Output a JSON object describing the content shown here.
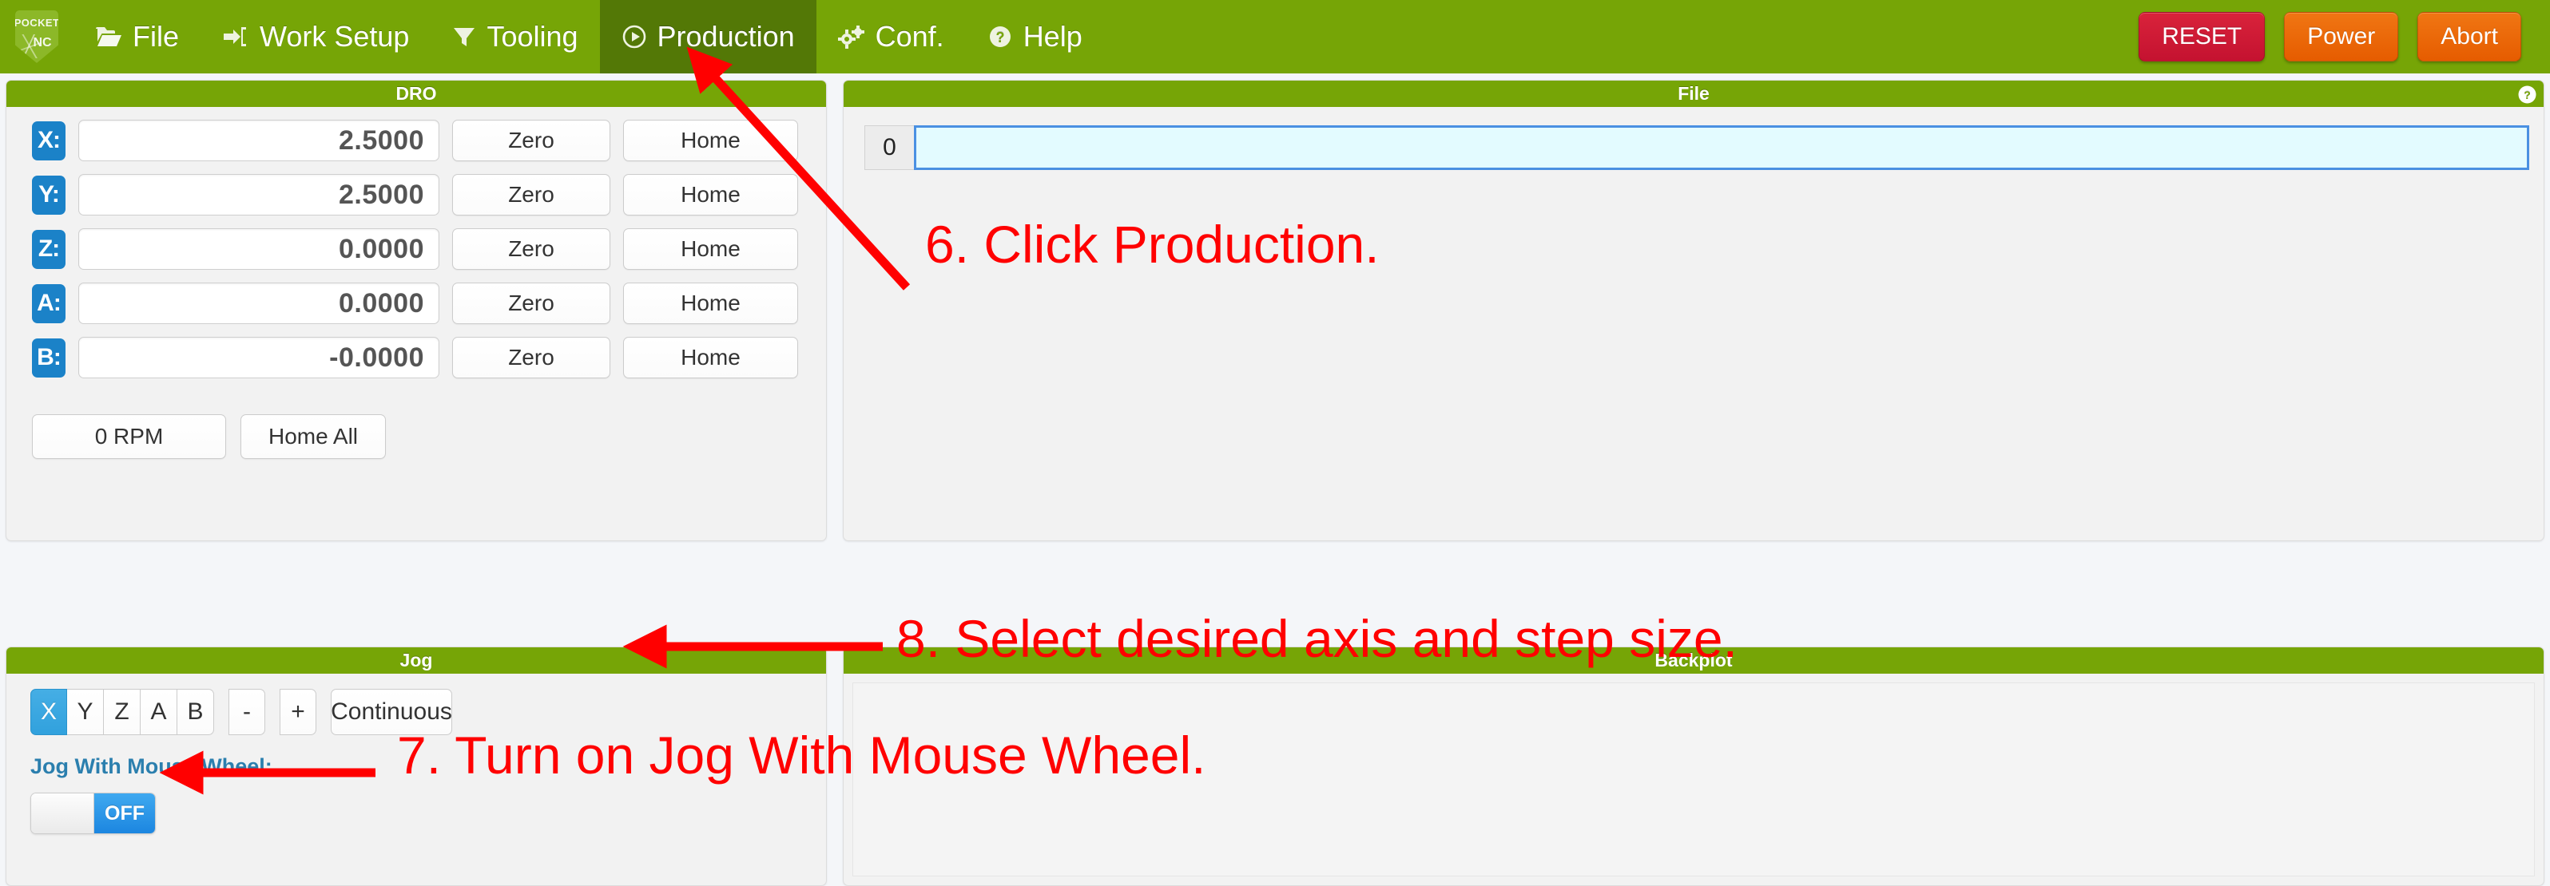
{
  "navbar": {
    "brand": {
      "line1": "POCKET",
      "line2": "NC",
      "name": "Pocket NC"
    },
    "items": [
      {
        "label": "File",
        "icon": "folder-open-icon",
        "active": false
      },
      {
        "label": "Work Setup",
        "icon": "sign-in-icon",
        "active": false
      },
      {
        "label": "Tooling",
        "icon": "filter-icon",
        "active": false
      },
      {
        "label": "Production",
        "icon": "play-circle-icon",
        "active": true
      },
      {
        "label": "Conf.",
        "icon": "gears-icon",
        "active": false
      },
      {
        "label": "Help",
        "icon": "question-circle-icon",
        "active": false
      }
    ],
    "actions": [
      {
        "label": "RESET",
        "color": "#c41230"
      },
      {
        "label": "Power",
        "color": "#e65c00"
      },
      {
        "label": "Abort",
        "color": "#e65c00"
      }
    ]
  },
  "dro": {
    "title": "DRO",
    "zero_label": "Zero",
    "home_label": "Home",
    "axes": [
      {
        "axis": "X:",
        "value": "2.5000"
      },
      {
        "axis": "Y:",
        "value": "2.5000"
      },
      {
        "axis": "Z:",
        "value": "0.0000"
      },
      {
        "axis": "A:",
        "value": "0.0000"
      },
      {
        "axis": "B:",
        "value": "-0.0000"
      }
    ],
    "rpm_label": "0 RPM",
    "home_all_label": "Home All"
  },
  "jog": {
    "title": "Jog",
    "axes": [
      "X",
      "Y",
      "Z",
      "A",
      "B"
    ],
    "selected_axis": "X",
    "minus_label": "-",
    "plus_label": "+",
    "mode_label": "Continuous",
    "wheel_label": "Jog With Mouse Wheel:",
    "toggle_state": "OFF"
  },
  "file": {
    "title": "File",
    "help_icon": "question-circle-icon",
    "line_number": "0",
    "line_value": ""
  },
  "backplot": {
    "title": "Backplot"
  },
  "annotations": [
    {
      "id": "step6",
      "text": "6. Click Production.",
      "color": "#ff0000"
    },
    {
      "id": "step8",
      "text": "8. Select desired axis and step size.",
      "color": "#ff0000"
    },
    {
      "id": "step7",
      "text": "7. Turn on Jog With Mouse Wheel.",
      "color": "#ff0000"
    }
  ]
}
